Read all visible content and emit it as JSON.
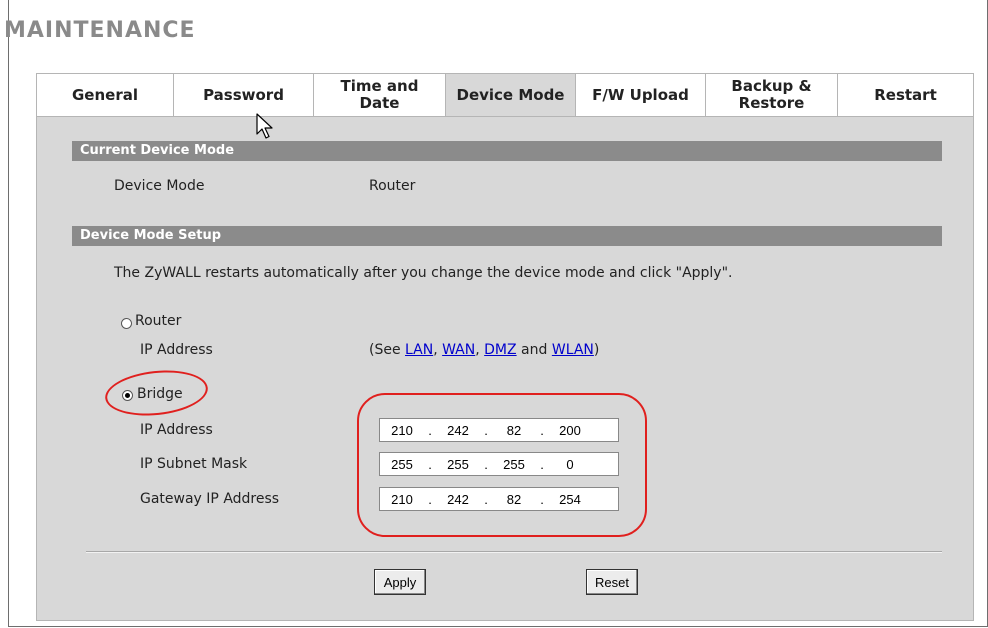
{
  "page": {
    "title": "MAINTENANCE"
  },
  "tabs": [
    {
      "label": "General",
      "active": false
    },
    {
      "label": "Password",
      "active": false
    },
    {
      "label": "Time and\nDate",
      "active": false
    },
    {
      "label": "Device Mode",
      "active": true
    },
    {
      "label": "F/W Upload",
      "active": false
    },
    {
      "label": "Backup &\nRestore",
      "active": false
    },
    {
      "label": "Restart",
      "active": false
    }
  ],
  "current_mode": {
    "section_title": "Current Device Mode",
    "label": "Device Mode",
    "value": "Router"
  },
  "setup": {
    "section_title": "Device Mode Setup",
    "note": "The ZyWALL restarts automatically after you change the device mode and click \"Apply\".",
    "router": {
      "label": "Router",
      "selected": false,
      "ip_label": "IP Address",
      "see_prefix": "(See ",
      "links": [
        "LAN",
        "WAN",
        "DMZ",
        "WLAN"
      ],
      "sep1": ", ",
      "sep2": ", ",
      "sep3": " and ",
      "see_suffix": ")"
    },
    "bridge": {
      "label": "Bridge",
      "selected": true,
      "ip_label": "IP Address",
      "subnet_label": "IP Subnet Mask",
      "gateway_label": "Gateway IP Address",
      "ip": [
        "210",
        "242",
        "82",
        "200"
      ],
      "subnet": [
        "255",
        "255",
        "255",
        "0"
      ],
      "gateway": [
        "210",
        "242",
        "82",
        "254"
      ]
    }
  },
  "buttons": {
    "apply": "Apply",
    "reset": "Reset"
  },
  "colors": {
    "annotation": "#e0201e",
    "link": "#0000cc",
    "section_bar": "#8b8b8b",
    "panel": "#d8d8d8"
  },
  "icons": {
    "cursor": "mouse-pointer-icon"
  }
}
